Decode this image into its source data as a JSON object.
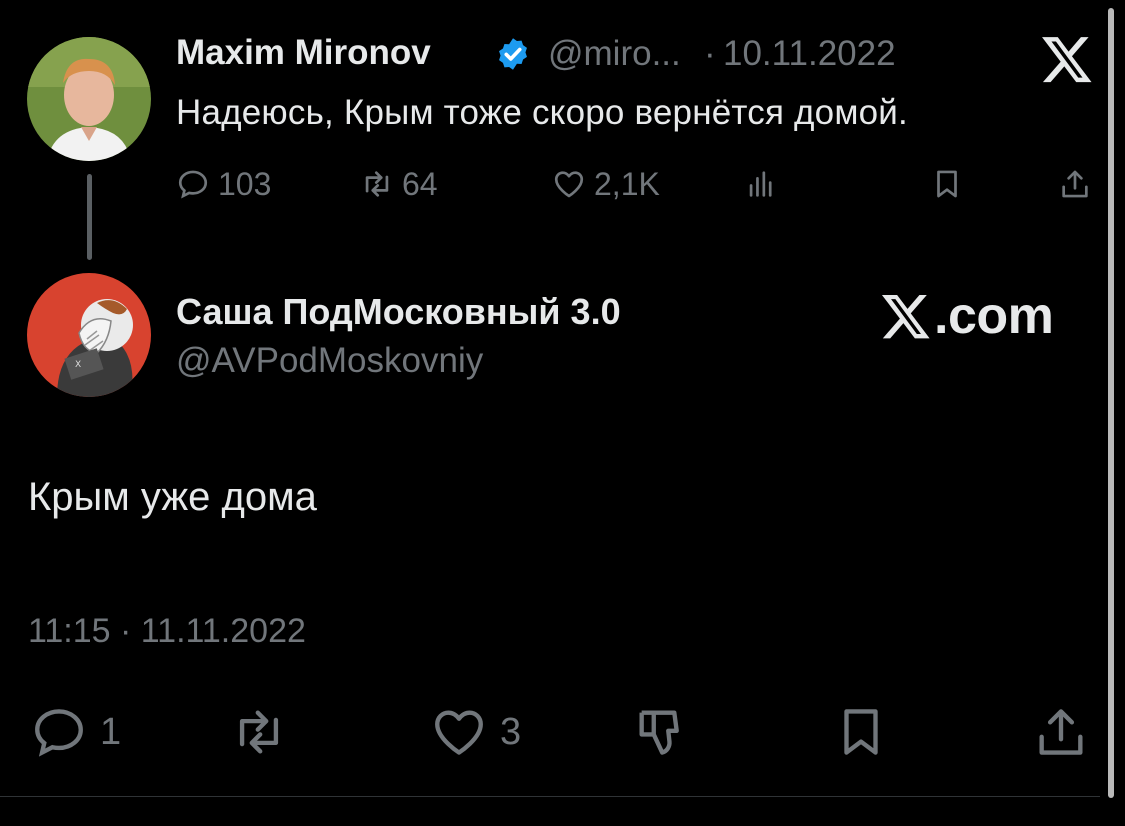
{
  "parent_tweet": {
    "author_name": "Maxim Mironov",
    "handle": "@miro...",
    "separator": "·",
    "date": "10.11.2022",
    "text": "Надеюсь, Крым тоже скоро вернётся домой.",
    "stats": {
      "replies": "103",
      "retweets": "64",
      "likes": "2,1K"
    }
  },
  "reply_tweet": {
    "author_name": "Саша ПодМосковный 3.0",
    "handle": "@AVPodMoskovniy",
    "text": "Крым уже дома",
    "timestamp": "11:15 · 11.11.2022",
    "stats": {
      "replies": "1",
      "likes": "3"
    }
  },
  "brand": {
    "xcom_label": ".com"
  },
  "colors": {
    "background": "#000000",
    "primary_text": "#e7e9ea",
    "secondary_text": "#71767b",
    "verified": "#1d9bf0",
    "avatar_red": "#d8432f"
  }
}
